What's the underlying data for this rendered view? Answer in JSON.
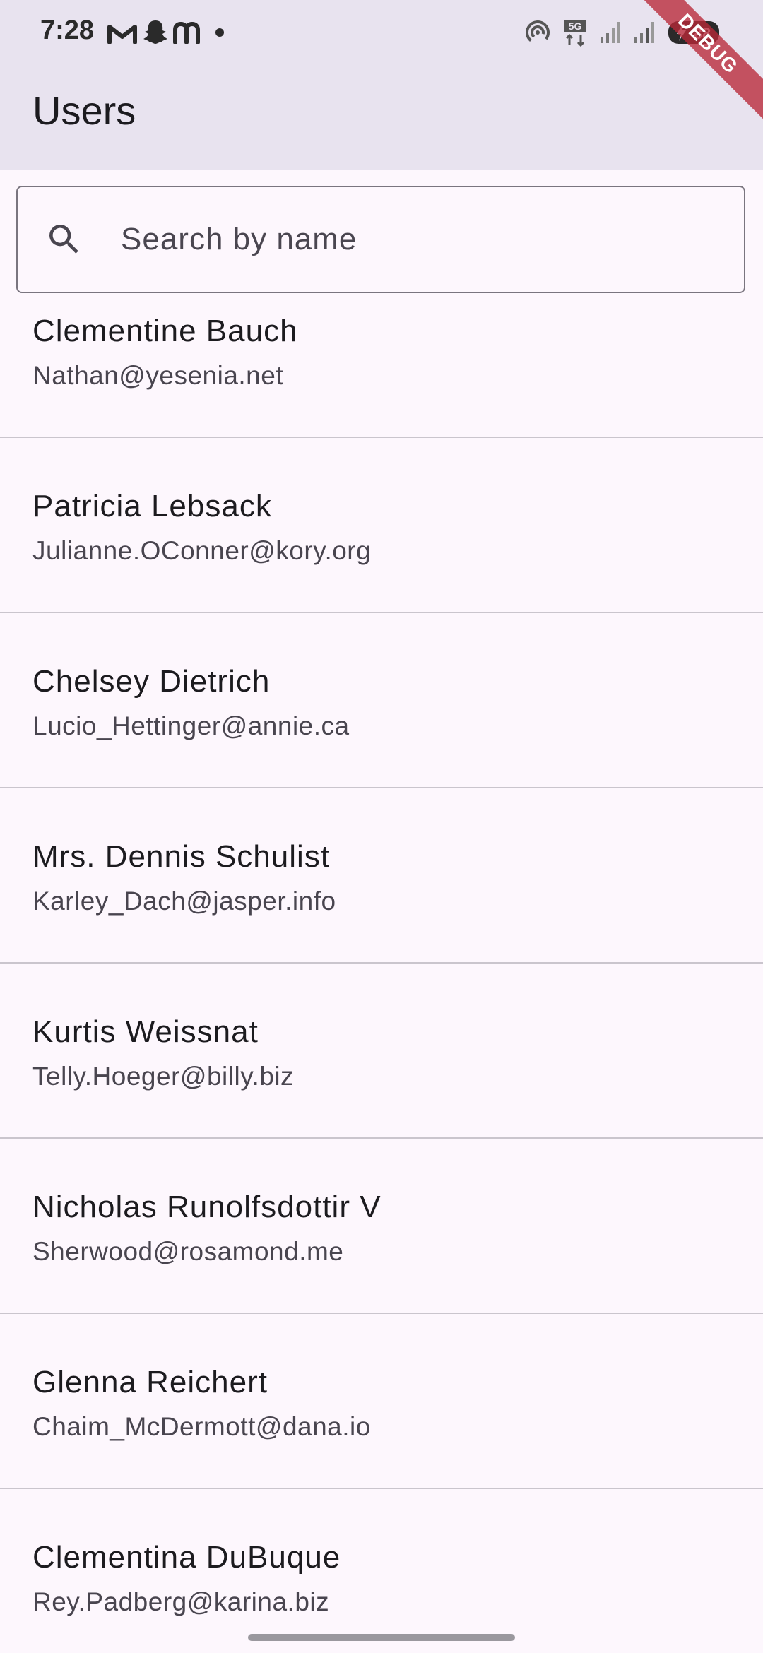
{
  "status_bar": {
    "time": "7:28",
    "network_label": "5G",
    "battery_level": "88",
    "icons": [
      "gmail-icon",
      "snapchat-icon",
      "messenger-icon",
      "dot-icon",
      "hotspot-icon",
      "network-5g-icon",
      "signal-icon",
      "signal-icon",
      "battery-charging-icon"
    ]
  },
  "debug_banner": "DEBUG",
  "app_bar": {
    "title": "Users"
  },
  "search": {
    "placeholder": "Search by name",
    "value": "",
    "icon": "search-icon"
  },
  "users": [
    {
      "name": "Clementine Bauch",
      "email": "Nathan@yesenia.net"
    },
    {
      "name": "Patricia Lebsack",
      "email": "Julianne.OConner@kory.org"
    },
    {
      "name": "Chelsey Dietrich",
      "email": "Lucio_Hettinger@annie.ca"
    },
    {
      "name": "Mrs. Dennis Schulist",
      "email": "Karley_Dach@jasper.info"
    },
    {
      "name": "Kurtis Weissnat",
      "email": "Telly.Hoeger@billy.biz"
    },
    {
      "name": "Nicholas Runolfsdottir V",
      "email": "Sherwood@rosamond.me"
    },
    {
      "name": "Glenna Reichert",
      "email": "Chaim_McDermott@dana.io"
    },
    {
      "name": "Clementina DuBuque",
      "email": "Rey.Padberg@karina.biz"
    }
  ],
  "colors": {
    "app_bar_bg": "#e8e3ef",
    "page_bg": "#fdf7fd",
    "divider": "#cac5cd",
    "debug_ribbon": "#b82837"
  }
}
